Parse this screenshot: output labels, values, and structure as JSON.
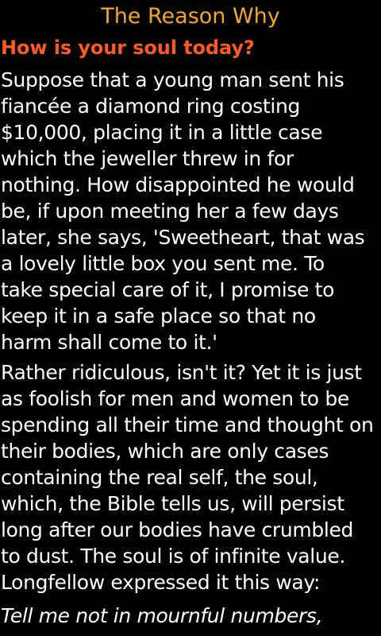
{
  "app": {
    "title": "The Reason Why"
  },
  "article": {
    "heading": "How is your soul today?",
    "paragraph1": "Suppose that a young man sent his\nfiancée a diamond ring costing\n$10,000, placing it in a little case\nwhich the jeweller threw in for\nnothing. How disappointed he would\nbe, if upon meeting her a few days\nlater, she says, 'Sweetheart, that was\na lovely little box you sent me. To\ntake special care of it, I promise to\nkeep it in a safe place so that no\nharm shall come to it.'",
    "paragraph2": "Rather ridiculous, isn't it? Yet it is just\nas foolish for men and women to be\nspending all their time and thought on\ntheir bodies, which are only cases\ncontaining the real self, the soul,\nwhich, the Bible tells us, will persist\nlong after our bodies have crumbled\nto dust. The soul is of infinite value.\nLongfellow expressed it this way:",
    "quote_line": "Tell me not in mournful numbers,"
  },
  "colors": {
    "background": "#000000",
    "title": "#f5a623",
    "heading": "#ff5a1f",
    "body_text": "#ffffff"
  }
}
